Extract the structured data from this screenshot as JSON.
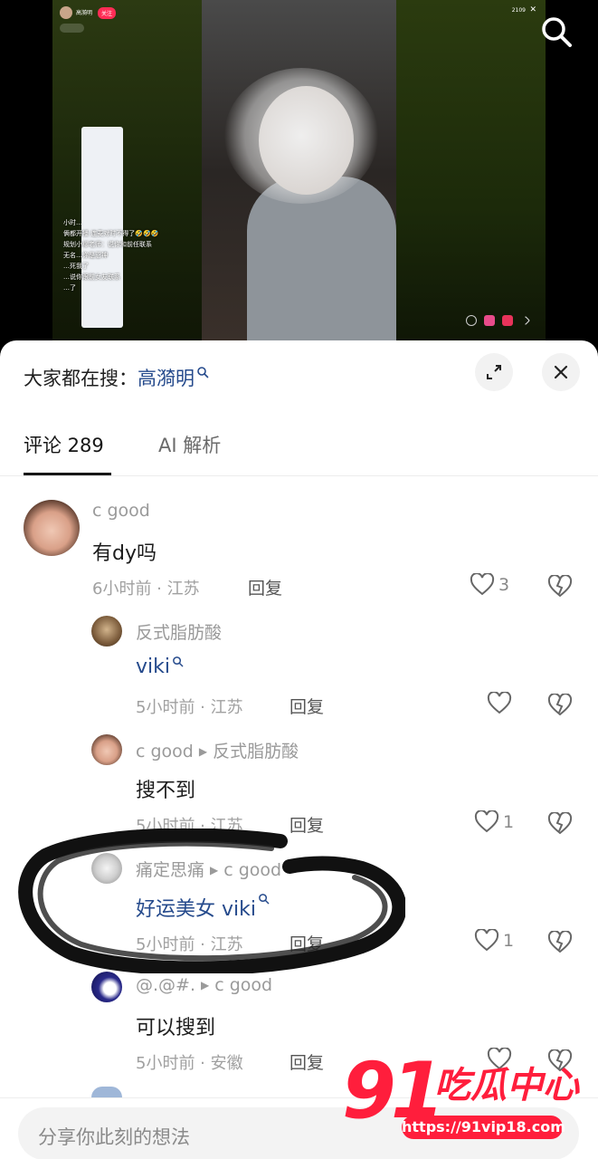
{
  "live": {
    "streamer_name": "高漪明",
    "follow_label": "关注",
    "viewer_count": "2109",
    "chat": [
      "小时…",
      "俩都开播 连麦对时不得了🤣🤣🤣",
      "规划小缪老师：说你和前任联系",
      "无名…你是忍神",
      "…死我了",
      "…说你跟前女友联系",
      "…了"
    ]
  },
  "sheet": {
    "hot_search_prefix": "大家都在搜：",
    "hot_search_keyword": "高漪明",
    "tabs": [
      {
        "label": "评论 289"
      },
      {
        "label": "AI 解析"
      }
    ]
  },
  "comments": [
    {
      "author": "c good",
      "reply_to": "",
      "text": "有dy吗",
      "time_loc": "6小时前 · 江苏",
      "reply_label": "回复",
      "likes": "3",
      "is_link": false
    },
    {
      "author": "反式脂肪酸",
      "reply_to": "",
      "text": "viki",
      "time_loc": "5小时前 · 江苏",
      "reply_label": "回复",
      "likes": "",
      "is_link": true
    },
    {
      "author": "c good",
      "reply_to": "反式脂肪酸",
      "text": "搜不到",
      "time_loc": "5小时前 · 江苏",
      "reply_label": "回复",
      "likes": "1",
      "is_link": false
    },
    {
      "author": "痛定思痛",
      "reply_to": "c good",
      "text": "好运美女 viki",
      "time_loc": "5小时前 · 江苏",
      "reply_label": "回复",
      "likes": "1",
      "is_link": true
    },
    {
      "author": "@.@#.",
      "reply_to": "c good",
      "text": "可以搜到",
      "time_loc": "5小时前 · 安徽",
      "reply_label": "回复",
      "likes": "",
      "is_link": false
    }
  ],
  "input": {
    "placeholder": "分享你此刻的想法"
  },
  "watermark": {
    "brand_number": "91",
    "brand_text": "吃瓜中心",
    "url": "https://91vip18.com"
  },
  "colors": {
    "accent_link": "#254a8c",
    "watermark_red": "#ff1e3c",
    "live_red": "#fe2c55"
  }
}
